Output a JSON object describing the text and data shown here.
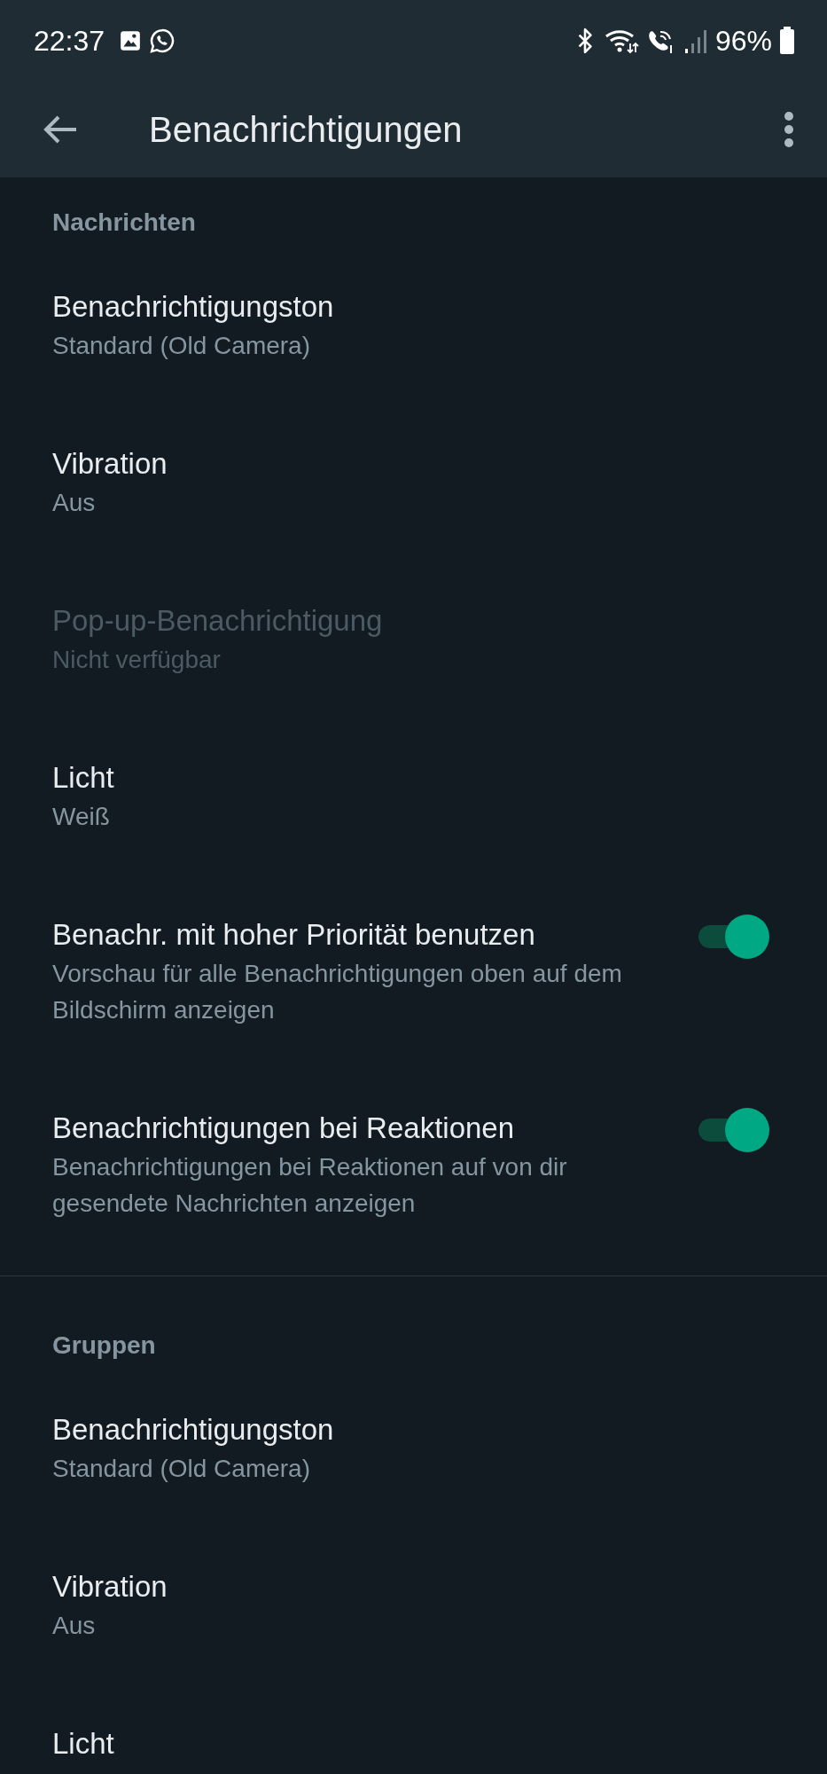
{
  "status_bar": {
    "time": "22:37",
    "battery": "96%"
  },
  "app_bar": {
    "title": "Benachrichtigungen"
  },
  "sections": [
    {
      "header": "Nachrichten",
      "items": [
        {
          "kind": "setting",
          "title": "Benachrichtigungston",
          "subtitle": "Standard (Old Camera)",
          "disabled": false
        },
        {
          "kind": "setting",
          "title": "Vibration",
          "subtitle": "Aus",
          "disabled": false
        },
        {
          "kind": "setting",
          "title": "Pop-up-Benachrichtigung",
          "subtitle": "Nicht verfügbar",
          "disabled": true
        },
        {
          "kind": "setting",
          "title": "Licht",
          "subtitle": "Weiß",
          "disabled": false
        },
        {
          "kind": "toggle",
          "title": "Benachr. mit hoher Priorität benutzen",
          "subtitle": "Vorschau für alle Benachrichtigungen oben auf dem Bildschirm anzeigen",
          "on": true
        },
        {
          "kind": "toggle",
          "title": "Benachrichtigungen bei Reaktionen",
          "subtitle": "Benachrichtigungen bei Reaktionen auf von dir gesendete Nachrichten anzeigen",
          "on": true
        }
      ]
    },
    {
      "header": "Gruppen",
      "items": [
        {
          "kind": "setting",
          "title": "Benachrichtigungston",
          "subtitle": "Standard (Old Camera)",
          "disabled": false
        },
        {
          "kind": "setting",
          "title": "Vibration",
          "subtitle": "Aus",
          "disabled": false
        },
        {
          "kind": "setting",
          "title": "Licht",
          "disabled": false
        }
      ]
    }
  ]
}
